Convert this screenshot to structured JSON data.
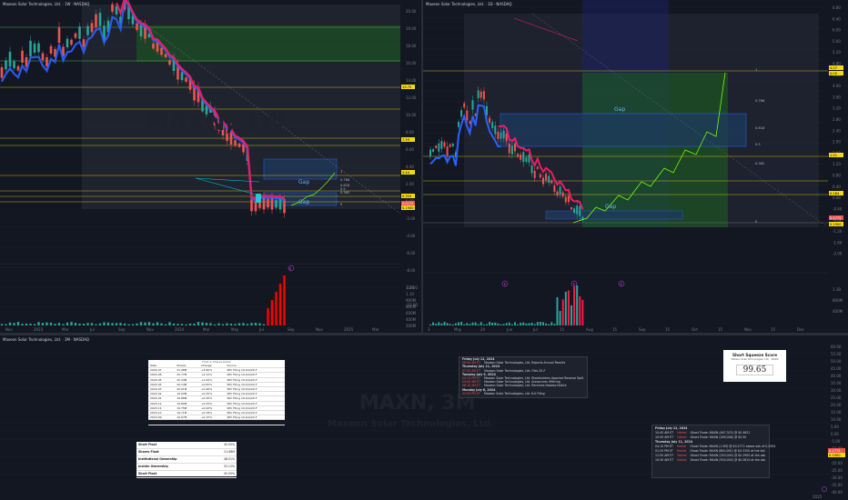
{
  "panes": {
    "top_left": {
      "header": "Maxeon Solar Technologies, Ltd. · 1W · NASDAQ",
      "watermark": "MAXN, 1W",
      "x_ticks": [
        "Nov",
        "2023",
        "Mar",
        "Jul",
        "Sep",
        "Nov",
        "2024",
        "Mar",
        "May",
        "Jul",
        "Sep",
        "Nov",
        "2025",
        "Mar"
      ],
      "y_ticks": [
        "20.00",
        "19.00",
        "18.00",
        "16.00",
        "14.00",
        "12.00",
        "10.00",
        "8.00",
        "6.00",
        "4.00",
        "2.00",
        "0.00",
        "-2.00",
        "-4.00",
        "-6.00",
        "-8.00",
        "-10.00",
        "-12.00"
      ],
      "price_labels": [
        {
          "text": "13.75",
          "color": "#f5d90a"
        },
        {
          "text": "7.59",
          "color": "#f5d90a"
        },
        {
          "text": "4.44",
          "color": "#f5d90a"
        },
        {
          "text": "0.354",
          "color": "#f5d90a"
        },
        {
          "text": "0.0175",
          "color": "#ef5350"
        },
        {
          "text": "0.1900",
          "color": "#f5d90a"
        }
      ],
      "fib_labels": [
        "1",
        "0.786",
        "0.618",
        "0.5",
        "0.382",
        "0"
      ],
      "gap_labels": [
        "Gap",
        "Gap"
      ],
      "volume_scale": [
        "1.2B",
        "1.10",
        "900M",
        "800M",
        "600M",
        "400M",
        "200M"
      ],
      "event_marker": "E"
    },
    "top_right": {
      "header": "Maxeon Solar Technologies, Ltd. · 1D · NASDAQ",
      "x_ticks": [
        "3",
        "May",
        "20",
        "Jun",
        "Jul",
        "15",
        "Aug",
        "15",
        "Sep",
        "15",
        "Oct",
        "15",
        "Nov",
        "15",
        "Dec"
      ],
      "y_ticks": [
        "6.80",
        "6.40",
        "6.00",
        "5.60",
        "5.20",
        "4.80",
        "4.40",
        "4.00",
        "3.60",
        "3.20",
        "2.80",
        "2.40",
        "2.00",
        "1.60",
        "1.20",
        "0.80",
        "0.40",
        "0.00",
        "-0.40",
        "-0.80",
        "-1.20",
        "-1.60",
        "-2.00"
      ],
      "price_labels": [
        {
          "text": "4.27",
          "color": "#f5d90a"
        },
        {
          "text": "4.05",
          "color": "#f5d90a"
        },
        {
          "text": "1.51",
          "color": "#f5d90a"
        },
        {
          "text": "0.284",
          "color": "#f5d90a"
        },
        {
          "text": "0.1775",
          "color": "#ef5350"
        },
        {
          "text": "0.1900",
          "color": "#f5d90a"
        }
      ],
      "fib_labels": [
        "1",
        "0.786",
        "0.618",
        "0.5",
        "0.382",
        "0"
      ],
      "gap_labels": [
        "Gap",
        "Gap"
      ],
      "volume_scale": [
        "1.2B",
        "800M",
        "400M"
      ],
      "event_markers": [
        "E",
        "E",
        "E"
      ]
    },
    "bottom": {
      "header": "Maxeon Solar Technologies, Ltd. · 3M · NASDAQ",
      "watermark": "MAXN, 3M",
      "watermark_sub": "Maxeon Solar Technologies, Ltd.",
      "y_ticks": [
        "60.00",
        "55.00",
        "50.00",
        "45.00",
        "40.00",
        "35.00",
        "30.00",
        "25.00",
        "20.00",
        "15.00",
        "10.00",
        "5.00",
        "0.00",
        "-5.00",
        "-10.00",
        "-15.00",
        "-20.00",
        "-25.00",
        "-30.00",
        "-35.00",
        "-40.00"
      ],
      "price_labels": [
        {
          "text": "0.1775",
          "color": "#ef5350"
        },
        {
          "text": "0.1900",
          "color": "#f5d90a"
        }
      ],
      "year_label": "2025"
    }
  },
  "short_table": {
    "rows": [
      [
        "Short Float",
        "45.55%"
      ],
      [
        "Shares Float",
        "21.98M"
      ],
      [
        "Institutional Ownership",
        "48.01%"
      ],
      [
        "Insider Ownership",
        "32.12%"
      ],
      [
        "Short Float",
        "45.55%"
      ]
    ]
  },
  "squeeze_card": {
    "title": "Short Squeeze Score",
    "subtitle": "Maxeon Solar Technologies, Ltd. · MAXN",
    "score": "99.65"
  },
  "alerts_card": {
    "date": "Friday July 12, 2024",
    "rows": [
      {
        "time": "10:45 AM ET",
        "tag": "Halted",
        "text": "Ghost Trade: MAXN (467,323) @ $0.4621"
      },
      {
        "time": "10:45 AM ET",
        "tag": "Halted",
        "text": "Ghost Trade: MAXN (269,008) @ $0.50"
      },
      {
        "time": "Thursday July 11, 2024",
        "tag": "",
        "text": ""
      },
      {
        "time": "04:10 PM ET",
        "tag": "Halted",
        "text": "Ghost Trade: MAXN (1.5M) @ $0.2772 above ask of 0.2594"
      },
      {
        "time": "01:20 PM ET",
        "tag": "Halted",
        "text": "Ghost Trade: MAXN (800,000) @ $0.3150 at the bid"
      },
      {
        "time": "11:50 AM ET",
        "tag": "Halted",
        "text": "Ghost Trade: MAXN (250,000) @ $0.2900 at the ask"
      },
      {
        "time": "10:30 AM ET",
        "tag": "Halted",
        "text": "Ghost Trade: MAXN (500,000) @ $0.2810 at the ask"
      }
    ]
  },
  "news_card": {
    "rows": [
      {
        "date": "Friday July 12, 2024",
        "time": "",
        "text": ""
      },
      {
        "date": "",
        "time": "06:30 AM ET",
        "text": "Maxeon Solar Technologies, Ltd. Reports Annual Results"
      },
      {
        "date": "Thursday July 11, 2024",
        "time": "",
        "text": ""
      },
      {
        "date": "",
        "time": "07:00 AM ET",
        "text": "Maxeon Solar Technologies, Ltd. Files 20-F"
      },
      {
        "date": "Tuesday July 9, 2024",
        "time": "",
        "text": ""
      },
      {
        "date": "",
        "time": "04:15 PM ET",
        "text": "Maxeon Solar Technologies, Ltd. Shareholders Approve Reverse Split"
      },
      {
        "date": "",
        "time": "09:00 AM ET",
        "text": "Maxeon Solar Technologies, Ltd. Announces Offering"
      },
      {
        "date": "",
        "time": "08:10 AM ET",
        "text": "Maxeon Solar Technologies, Ltd. Receives Nasdaq Notice"
      },
      {
        "date": "Monday July 8, 2024",
        "time": "",
        "text": ""
      },
      {
        "date": "",
        "time": "05:00 PM ET",
        "text": "Maxeon Solar Technologies, Ltd. 6-K Filing"
      }
    ]
  },
  "float_table": {
    "title": "Float & Shares Detail",
    "headers": [
      "Date",
      "Shares",
      "Change",
      "Source"
    ],
    "rows": [
      [
        "2024-07",
        "21.98M",
        "+5.80%",
        "SEC Filing 10-K/A/20-F"
      ],
      [
        "2024-06",
        "20.77M",
        "+2.12%",
        "SEC Filing 10-K/A/20-F"
      ],
      [
        "2024-05",
        "20.34M",
        "+1.00%",
        "SEC Filing 10-K/A/20-F"
      ],
      [
        "2024-04",
        "20.14M",
        "+0.65%",
        "SEC Filing 10-K/A/20-F"
      ],
      [
        "2024-03",
        "20.01M",
        "+0.40%",
        "SEC Filing 10-K/A/20-F"
      ],
      [
        "2024-02",
        "19.93M",
        "+0.35%",
        "SEC Filing 10-K/A/20-F"
      ],
      [
        "2024-01",
        "19.86M",
        "+0.30%",
        "SEC Filing 10-K/A/20-F"
      ],
      [
        "2023-12",
        "19.80M",
        "+0.25%",
        "SEC Filing 10-K/A/20-F"
      ],
      [
        "2023-11",
        "19.75M",
        "+0.20%",
        "SEC Filing 10-K/A/20-F"
      ],
      [
        "2023-10",
        "19.71M",
        "+0.18%",
        "SEC Filing 10-K/A/20-F"
      ],
      [
        "2023-09",
        "19.67M",
        "+0.15%",
        "SEC Filing 10-K/A/20-F"
      ],
      [
        "2023-08",
        "19.64M",
        "+0.12%",
        "SEC Filing 10-K/A/20-F"
      ]
    ]
  },
  "chart_data": [
    {
      "type": "line",
      "title": "",
      "note": "Weekly price trend, top-left pane (approx.)",
      "x": [
        "2023-01",
        "2023-03",
        "2023-05",
        "2023-07",
        "2023-09",
        "2023-11",
        "2024-01",
        "2024-03",
        "2024-05",
        "2024-07"
      ],
      "series": [
        {
          "name": "",
          "values": [
            14.5,
            17.0,
            19.5,
            20.0,
            13.0,
            8.0,
            5.5,
            4.0,
            2.0,
            0.18
          ]
        }
      ],
      "ylim": [
        -12,
        20
      ]
    },
    {
      "type": "line",
      "title": "",
      "note": "Daily price, top-right pane (approx.) with projection",
      "x": [
        "Apr",
        "May",
        "Jun",
        "Jul"
      ],
      "series": [
        {
          "name": "",
          "values": [
            3.1,
            3.6,
            1.8,
            0.18
          ]
        }
      ],
      "ylim": [
        -2,
        6.8
      ]
    }
  ]
}
